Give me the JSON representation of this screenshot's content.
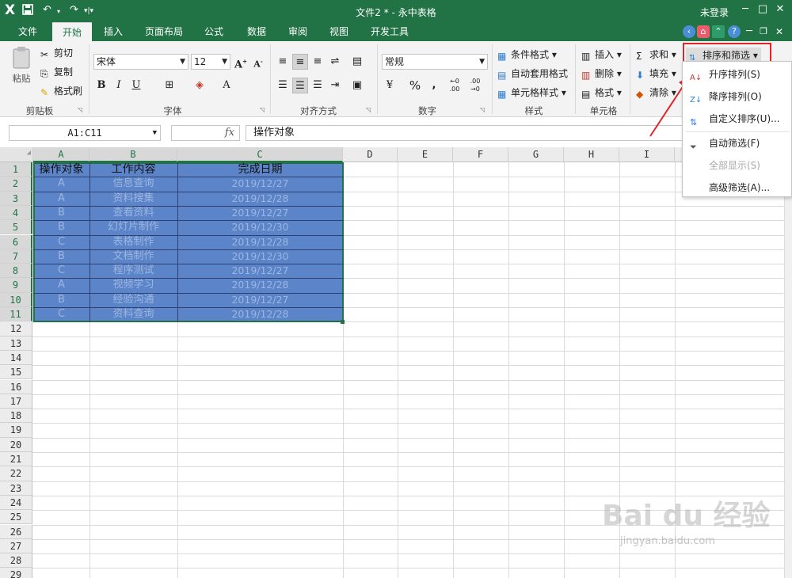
{
  "app": {
    "logo": "X",
    "window_title": "文件2 * - 永中表格",
    "login": "未登录",
    "controls": [
      "─",
      "□",
      "✕"
    ]
  },
  "tabs": [
    {
      "label": "文件",
      "active": false
    },
    {
      "label": "开始",
      "active": true
    },
    {
      "label": "插入",
      "active": false
    },
    {
      "label": "页面布局",
      "active": false
    },
    {
      "label": "公式",
      "active": false
    },
    {
      "label": "数据",
      "active": false
    },
    {
      "label": "审阅",
      "active": false
    },
    {
      "label": "视图",
      "active": false
    },
    {
      "label": "开发工具",
      "active": false
    }
  ],
  "ribbon": {
    "clipboard": {
      "paste": "粘贴",
      "cut": "剪切",
      "copy": "复制",
      "format_painter": "格式刷",
      "label": "剪贴板"
    },
    "font": {
      "name": "宋体",
      "size": "12",
      "label": "字体",
      "bold": "B",
      "italic": "I",
      "underline": "U"
    },
    "alignment": {
      "label": "对齐方式"
    },
    "number": {
      "format": "常规",
      "label": "数字",
      "percent": "%",
      "comma": ","
    },
    "styles": {
      "conditional": "条件格式",
      "table_style": "自动套用格式",
      "cell_style": "单元格样式",
      "label": "样式"
    },
    "cells": {
      "insert": "插入",
      "delete": "删除",
      "format": "格式",
      "label": "单元格"
    },
    "editing": {
      "sum": "求和",
      "fill": "填充",
      "clear": "清除",
      "sort_filter": "排序和筛选"
    }
  },
  "sort_menu": {
    "items": [
      {
        "label": "升序排列(S)",
        "disabled": false
      },
      {
        "label": "降序排列(O)",
        "disabled": false
      },
      {
        "label": "自定义排序(U)...",
        "disabled": false
      },
      {
        "label": "自动筛选(F)",
        "disabled": false
      },
      {
        "label": "全部显示(S)",
        "disabled": true
      },
      {
        "label": "高级筛选(A)...",
        "disabled": false
      }
    ]
  },
  "formula_bar": {
    "name_box": "A1:C11",
    "fx": "fx",
    "content": "操作对象"
  },
  "sheet": {
    "columns": [
      "A",
      "B",
      "C",
      "D",
      "E",
      "F",
      "G",
      "H",
      "I"
    ],
    "rows": [
      "1",
      "2",
      "3",
      "4",
      "5",
      "6",
      "7",
      "8",
      "9",
      "10",
      "11",
      "12",
      "13",
      "14",
      "15",
      "16",
      "17",
      "18",
      "19",
      "20",
      "21",
      "22",
      "23",
      "24",
      "25",
      "26",
      "27",
      "28",
      "29"
    ],
    "headers": [
      "操作对象",
      "工作内容",
      "完成日期"
    ],
    "data": [
      [
        "A",
        "信息查询",
        "2019/12/27"
      ],
      [
        "A",
        "资料搜集",
        "2019/12/28"
      ],
      [
        "B",
        "查看资料",
        "2019/12/27"
      ],
      [
        "B",
        "幻灯片制作",
        "2019/12/30"
      ],
      [
        "C",
        "表格制作",
        "2019/12/28"
      ],
      [
        "B",
        "文档制作",
        "2019/12/30"
      ],
      [
        "C",
        "程序测试",
        "2019/12/27"
      ],
      [
        "A",
        "视频学习",
        "2019/12/28"
      ],
      [
        "B",
        "经验沟通",
        "2019/12/27"
      ],
      [
        "C",
        "资料查询",
        "2019/12/28"
      ]
    ]
  },
  "watermark": {
    "brand": "Bai du 经验",
    "url": "jingyan.baidu.com"
  },
  "colors": {
    "accent": "#217346",
    "selection": "#5b84c9",
    "highlight": "#e0242b"
  }
}
